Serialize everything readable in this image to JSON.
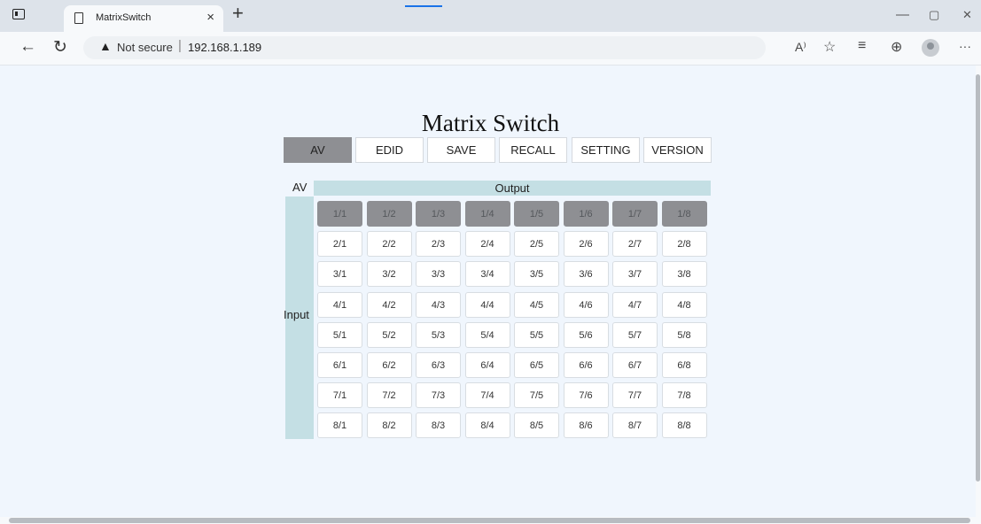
{
  "browser": {
    "tab_title": "MatrixSwitch",
    "tab_close": "×",
    "new_tab": "+",
    "security_label": "Not secure",
    "url": "192.168.1.189",
    "window_min": "—",
    "window_max": "▢",
    "window_close": "✕",
    "icons": {
      "back": "←",
      "refresh": "↻",
      "warning": "▲",
      "read_aloud": "A⁾",
      "favorite": "☆",
      "favorites": "≡",
      "collections": "⊕",
      "more": "···"
    }
  },
  "page": {
    "title": "Matrix Switch",
    "menu": [
      "AV",
      "EDID",
      "SAVE",
      "RECALL",
      "SETTING",
      "VERSION"
    ],
    "active_menu": "AV",
    "av_label": "AV",
    "output_label": "Output",
    "input_label": "Input",
    "active_row": 1,
    "grid": [
      [
        "1/1",
        "1/2",
        "1/3",
        "1/4",
        "1/5",
        "1/6",
        "1/7",
        "1/8"
      ],
      [
        "2/1",
        "2/2",
        "2/3",
        "2/4",
        "2/5",
        "2/6",
        "2/7",
        "2/8"
      ],
      [
        "3/1",
        "3/2",
        "3/3",
        "3/4",
        "3/5",
        "3/6",
        "3/7",
        "3/8"
      ],
      [
        "4/1",
        "4/2",
        "4/3",
        "4/4",
        "4/5",
        "4/6",
        "4/7",
        "4/8"
      ],
      [
        "5/1",
        "5/2",
        "5/3",
        "5/4",
        "5/5",
        "5/6",
        "5/7",
        "5/8"
      ],
      [
        "6/1",
        "6/2",
        "6/3",
        "6/4",
        "6/5",
        "6/6",
        "6/7",
        "6/8"
      ],
      [
        "7/1",
        "7/2",
        "7/3",
        "7/4",
        "7/5",
        "7/6",
        "7/7",
        "7/8"
      ],
      [
        "8/1",
        "8/2",
        "8/3",
        "8/4",
        "8/5",
        "8/6",
        "8/7",
        "8/8"
      ]
    ]
  }
}
